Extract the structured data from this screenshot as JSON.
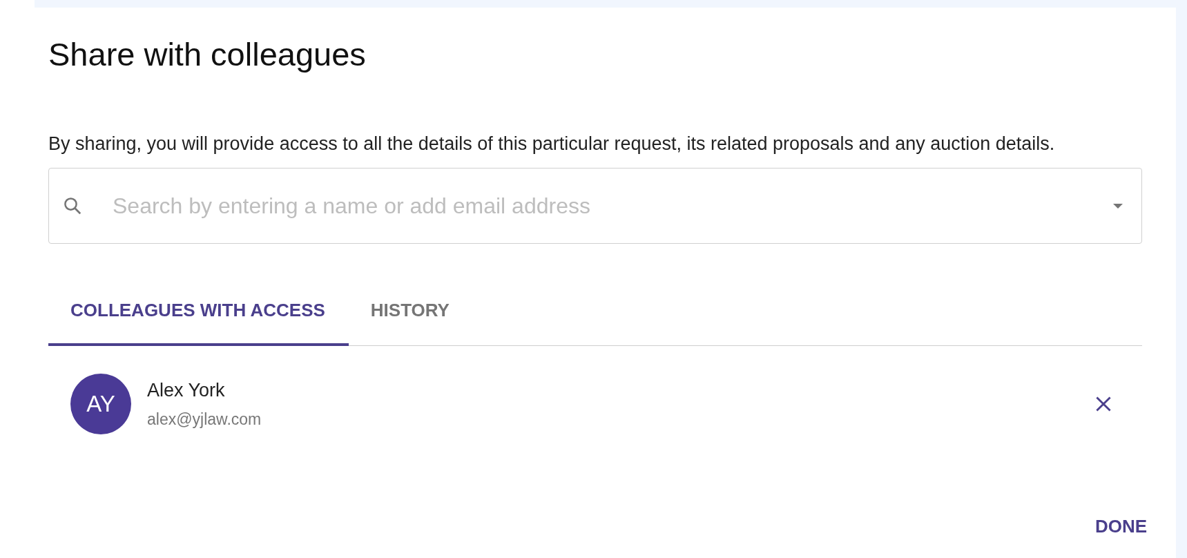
{
  "dialog": {
    "title": "Share with colleagues",
    "description": "By sharing, you will provide access to all the details of this particular request, its related proposals and any auction details."
  },
  "search": {
    "placeholder": "Search by entering a name or add email address"
  },
  "tabs": [
    {
      "label": "COLLEAGUES WITH ACCESS",
      "selected": true
    },
    {
      "label": "HISTORY",
      "selected": false
    }
  ],
  "colleagues": [
    {
      "initials": "AY",
      "name": "Alex York",
      "email": "alex@yjlaw.com"
    }
  ],
  "buttons": [
    "DONE"
  ]
}
